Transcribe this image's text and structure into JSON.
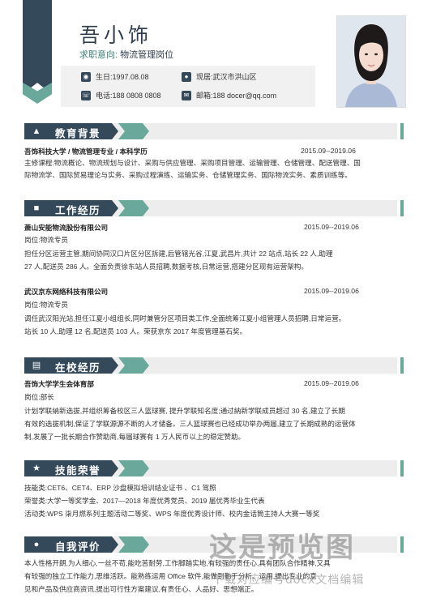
{
  "header": {
    "name": "吾小饰",
    "intention_label": "求职意向:",
    "intention_value": "物流管理岗位",
    "birthday": "生日:1997.08.08",
    "location": "现居:武汉市洪山区",
    "phone": "电话:188 0808 0808",
    "email": "邮箱:188 docer@qq.com"
  },
  "education": {
    "title": "教育背景",
    "school": "吾饰科技大学 / 物流管理专业 / 本科学历",
    "date": "2015.09--2019.06",
    "lines": [
      "主修课程:物流概论、物流规划与设计、采购与供应管理、采购项目管理、运输管理、仓储管理、配送管理、国",
      "际物流学、国际贸易理论与实务、采购过程演练、运输实务、仓储管理实务、国际物流实务、素质训练等。"
    ]
  },
  "work": {
    "title": "工作经历",
    "jobs": [
      {
        "company": "萧山安能物流股份有限公司",
        "date": "2015.09--2019.06",
        "position": "岗位:物流专员",
        "lines": [
          "担任分区运营主管,期间协同汉口片区分区拆建,后管辖光谷,江夏,武昌片,共计 22 站点,站长 22 人,助理",
          "27 人,配送员 286 人。全面负责徐东站人员招聘,数据考核,日常运营,搭建分区现有运营架构。"
        ]
      },
      {
        "company": "武汉京东网络科技有限公司",
        "date": "2015.09--2019.06",
        "position": "岗位:物流专员",
        "lines": [
          "调任武汉阳光站,担任江夏小组组长,同时兼管分区项目类工作,全面统筹江夏小组管理人员招聘,日常运营。",
          "站长 10 人,助理 12 名,配送员 103 人。荣获京东 2017 年度管理基石奖。"
        ]
      }
    ]
  },
  "campus": {
    "title": "在校经历",
    "org": "吾饰大学学生会体育部",
    "date": "2015.09--2019.06",
    "position": "岗位:部长",
    "lines": [
      "计划学联納新选拔,并组织筹备校区三人篮球赛, 提升学联知名度;通过納新学联成员超过 30 名,建立了长期",
      "有效的选拔机制,保证了学联源源不断的人才储备。三人篮球赛也已经成功举办两届,建立了长期成熟的运营体",
      "制,发展了一批长期合作赞助商,每届球赛有 1 万人民币以上的稳定赞助。"
    ]
  },
  "skills": {
    "title": "技能荣誉",
    "lines": [
      "技能类:CET6、CET4、ERP 沙盘模拟培训结业证书 、C1 驾照",
      "荣誉类:大学一等奖学金、2017—2018 年度优秀党员、2019 届优秀毕业生代表",
      "活动类:WPS 柒月燃系列主题活动二等奖、WPS 年度优秀设计师、校内金话筒主持人大赛一等奖"
    ]
  },
  "self": {
    "title": "自我评价",
    "lines": [
      "本人性格开朗,为人细心,一丝不苟,能吃苦耐劳,工作脚踏实地,有较强的责任心,具有团队合作精神,又具",
      "有较强的独立工作能力,思维活跃。能熟练运用 Office 软件,能做到勤于分析、运用,提出专业的意",
      "见和产品及供应商资讯,提出可行性方案建议,有责任心、人品好、思想端正。"
    ]
  },
  "watermark": {
    "big": "这是预览图",
    "small": "下载对应编号docx文档编辑"
  },
  "colors": {
    "navy": "#34495a",
    "teal": "#6aa89c"
  }
}
